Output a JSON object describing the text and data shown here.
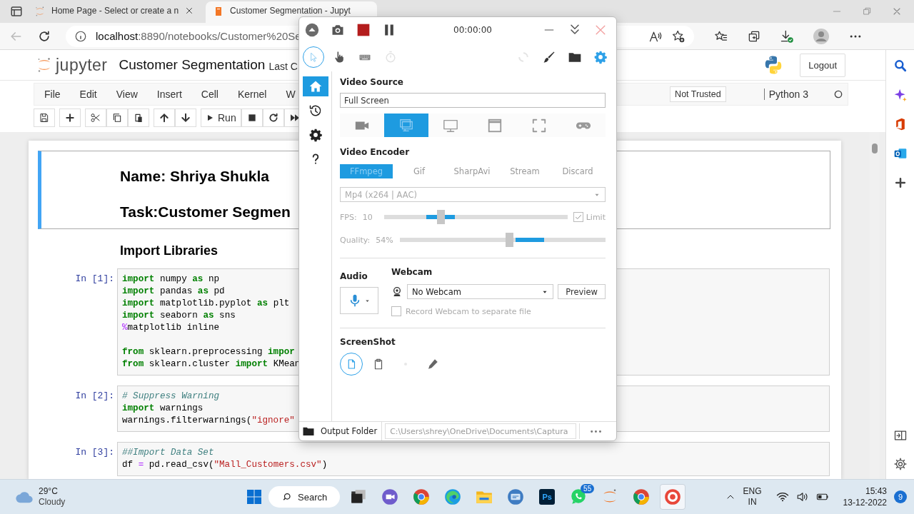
{
  "browser": {
    "tabs": [
      {
        "title": "Home Page - Select or create a n",
        "selected": false
      },
      {
        "title": "Customer Segmentation - Jupyt",
        "selected": true
      }
    ],
    "address": {
      "host": "localhost",
      "path": ":8890/notebooks/Customer%20Se"
    }
  },
  "jupyter": {
    "logo_text": "jupyter",
    "title": "Customer Segmentation",
    "checkpoint": "Last C",
    "logout": "Logout",
    "menu": [
      "File",
      "Edit",
      "View",
      "Insert",
      "Cell",
      "Kernel",
      "W"
    ],
    "trusted": "Not Trusted",
    "kernel": "Python 3",
    "run": "Run"
  },
  "notebook": {
    "cells": [
      {
        "kind": "markdown",
        "selected": true,
        "lines": [
          "Name: Shriya Shukla",
          "Task:Customer Segmen"
        ]
      },
      {
        "kind": "heading",
        "selected": false,
        "text": "Import Libraries"
      },
      {
        "kind": "code",
        "selected": false,
        "prompt": "In [1]:",
        "blocks": [
          {
            "lines": [
              {
                "tokens": [
                  {
                    "kind": "keyword",
                    "text": "import"
                  },
                  {
                    "kind": "plain",
                    "text": " numpy "
                  },
                  {
                    "kind": "keyword",
                    "text": "as"
                  },
                  {
                    "kind": "plain",
                    "text": " np"
                  }
                ]
              },
              {
                "tokens": [
                  {
                    "kind": "keyword",
                    "text": "import"
                  },
                  {
                    "kind": "plain",
                    "text": " pandas "
                  },
                  {
                    "kind": "keyword",
                    "text": "as"
                  },
                  {
                    "kind": "plain",
                    "text": " pd"
                  }
                ]
              },
              {
                "tokens": [
                  {
                    "kind": "keyword",
                    "text": "import"
                  },
                  {
                    "kind": "plain",
                    "text": " matplotlib.pyplot "
                  },
                  {
                    "kind": "keyword",
                    "text": "as"
                  },
                  {
                    "kind": "plain",
                    "text": " plt"
                  }
                ]
              },
              {
                "tokens": [
                  {
                    "kind": "keyword",
                    "text": "import"
                  },
                  {
                    "kind": "plain",
                    "text": " seaborn "
                  },
                  {
                    "kind": "keyword",
                    "text": "as"
                  },
                  {
                    "kind": "plain",
                    "text": " sns"
                  }
                ]
              },
              {
                "tokens": [
                  {
                    "kind": "operator",
                    "text": "%"
                  },
                  {
                    "kind": "plain",
                    "text": "matplotlib inline"
                  }
                ]
              }
            ]
          },
          {
            "lines": [
              {
                "tokens": [
                  {
                    "kind": "keyword",
                    "text": "from"
                  },
                  {
                    "kind": "plain",
                    "text": " sklearn.preprocessing "
                  },
                  {
                    "kind": "keyword",
                    "text": "impor"
                  }
                ]
              },
              {
                "tokens": [
                  {
                    "kind": "keyword",
                    "text": "from"
                  },
                  {
                    "kind": "plain",
                    "text": " sklearn.cluster "
                  },
                  {
                    "kind": "keyword",
                    "text": "import"
                  },
                  {
                    "kind": "plain",
                    "text": " KMean"
                  }
                ]
              }
            ]
          }
        ]
      },
      {
        "kind": "code",
        "selected": false,
        "prompt": "In [2]:",
        "blocks": [
          {
            "lines": [
              {
                "tokens": [
                  {
                    "kind": "comment",
                    "text": "# Suppress Warning"
                  }
                ]
              },
              {
                "tokens": [
                  {
                    "kind": "keyword",
                    "text": "import"
                  },
                  {
                    "kind": "plain",
                    "text": " warnings"
                  }
                ]
              },
              {
                "tokens": [
                  {
                    "kind": "plain",
                    "text": "warnings.filterwarnings("
                  },
                  {
                    "kind": "string",
                    "text": "\"ignore\""
                  }
                ]
              }
            ]
          }
        ]
      },
      {
        "kind": "code",
        "selected": false,
        "prompt": "In [3]:",
        "blocks": [
          {
            "lines": [
              {
                "tokens": [
                  {
                    "kind": "comment",
                    "text": "##Import Data Set"
                  }
                ]
              },
              {
                "tokens": [
                  {
                    "kind": "plain",
                    "text": "df "
                  },
                  {
                    "kind": "operator",
                    "text": "="
                  },
                  {
                    "kind": "plain",
                    "text": " pd.read_csv("
                  },
                  {
                    "kind": "string",
                    "text": "\"Mall_Customers.csv\""
                  },
                  {
                    "kind": "plain",
                    "text": ")"
                  }
                ]
              }
            ]
          }
        ]
      }
    ]
  },
  "recorder": {
    "timer": "00:00:00",
    "tools": [
      {
        "kind": "cursor",
        "selected": true
      },
      {
        "kind": "hand",
        "selected": false
      },
      {
        "kind": "keyboard",
        "selected": false
      },
      {
        "kind": "timer",
        "selected": false
      }
    ],
    "nav": [
      {
        "kind": "home",
        "selected": true
      },
      {
        "kind": "history",
        "selected": false
      },
      {
        "kind": "settings",
        "selected": false
      },
      {
        "kind": "help",
        "selected": false
      }
    ],
    "video_source": {
      "label": "Video Source",
      "value": "Full Screen",
      "sources": [
        {
          "kind": "webcam",
          "selected": false
        },
        {
          "kind": "screens",
          "selected": true
        },
        {
          "kind": "screen",
          "selected": false
        },
        {
          "kind": "window",
          "selected": false
        },
        {
          "kind": "region",
          "selected": false
        },
        {
          "kind": "game",
          "selected": false
        }
      ]
    },
    "video_encoder": {
      "label": "Video Encoder",
      "tabs": [
        {
          "label": "FFmpeg",
          "selected": true
        },
        {
          "label": "Gif",
          "selected": false
        },
        {
          "label": "SharpAvi",
          "selected": false
        },
        {
          "label": "Stream",
          "selected": false
        },
        {
          "label": "Discard",
          "selected": false
        }
      ],
      "format": "Mp4 (x264 | AAC)",
      "fps_label": "FPS:",
      "fps": "10",
      "fps_slider": {
        "level": 0.31
      },
      "limit": {
        "label": "Limit",
        "checked": true
      },
      "quality_label": "Quality:",
      "quality": "54%",
      "quality_slider": {
        "level": 0.53
      }
    },
    "audio": {
      "label": "Audio"
    },
    "webcam": {
      "label": "Webcam",
      "value": "No Webcam",
      "preview": "Preview",
      "separate": {
        "label": "Record Webcam to separate file",
        "checked": false
      }
    },
    "screenshot": {
      "label": "ScreenShot",
      "targets": [
        {
          "kind": "file",
          "selected": true
        },
        {
          "kind": "clipboard",
          "selected": false
        },
        {
          "kind": "dot",
          "selected": false
        },
        {
          "kind": "editor",
          "selected": false
        }
      ]
    },
    "output": {
      "label": "Output Folder",
      "path": "C:\\Users\\shrey\\OneDrive\\Documents\\Captura",
      "more": "•••"
    }
  },
  "taskbar": {
    "weather": {
      "temp": "29°C",
      "condition": "Cloudy"
    },
    "search": "Search",
    "apps": [
      {
        "kind": "taskview",
        "selected": false
      },
      {
        "kind": "meet",
        "selected": false
      },
      {
        "kind": "chrome",
        "selected": false
      },
      {
        "kind": "edge",
        "selected": false
      },
      {
        "kind": "folder",
        "selected": false
      },
      {
        "kind": "disk",
        "selected": false
      },
      {
        "kind": "ps",
        "text": "Ps",
        "selected": false
      },
      {
        "kind": "chat",
        "badge": "55",
        "selected": false
      },
      {
        "kind": "jupyter",
        "selected": false
      },
      {
        "kind": "chrome",
        "selected": false
      },
      {
        "kind": "target",
        "selected": true
      }
    ],
    "lang": "ENG",
    "region": "IN",
    "time": "15:43",
    "date": "13-12-2022",
    "notifications": "9"
  }
}
